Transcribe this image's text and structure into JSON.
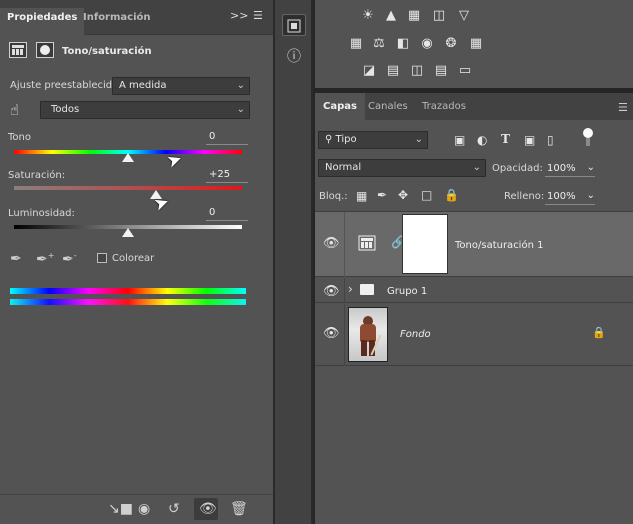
{
  "properties": {
    "tabs": [
      "Propiedades",
      "Información"
    ],
    "title": "Tono/saturación",
    "preset_label": "Ajuste preestablecido:",
    "preset_value": "A medida",
    "channel_value": "Todos",
    "sliders": [
      {
        "label": "Tono",
        "value": "0",
        "position": 0.5
      },
      {
        "label": "Saturación:",
        "value": "+25",
        "position": 0.625
      },
      {
        "label": "Luminosidad:",
        "value": "0",
        "position": 0.5
      }
    ],
    "colorize_label": "Colorear"
  },
  "layers": {
    "tabs": [
      "Capas",
      "Canales",
      "Trazados"
    ],
    "filter_value": "Tipo",
    "blend_mode": "Normal",
    "opacity_label": "Opacidad:",
    "opacity_value": "100%",
    "lock_label": "Bloq.:",
    "fill_label": "Relleno:",
    "fill_value": "100%",
    "items": [
      {
        "name": "Tono/saturación 1",
        "type": "adjustment",
        "selected": true
      },
      {
        "name": "Grupo 1",
        "type": "group"
      },
      {
        "name": "Fondo",
        "type": "background",
        "locked": true
      }
    ]
  },
  "colors": {
    "panel_bg": "#535353",
    "tab_bg": "#424242",
    "selected_layer": "#696969"
  },
  "icons": {
    "collapse": "double-chevron-right-icon",
    "menu": "hamburger-menu-icon"
  }
}
